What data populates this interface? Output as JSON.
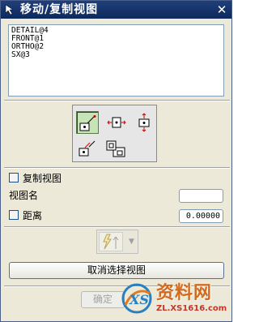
{
  "window": {
    "title": "移动/复制视图",
    "icon": "arrow-cursor-icon",
    "close_glyph": "✕"
  },
  "view_list": {
    "items": [
      "DETAIL@4",
      "FRONT@1",
      "ORTHO@2",
      "SX@3"
    ]
  },
  "tools": {
    "buttons": [
      {
        "name": "to-point-icon",
        "active": true
      },
      {
        "name": "horizontal-icon",
        "active": false
      },
      {
        "name": "vertical-icon",
        "active": false
      },
      {
        "name": "perpendicular-to-line-icon",
        "active": false
      },
      {
        "name": "to-another-drawing-icon",
        "active": false
      }
    ]
  },
  "options": {
    "copy_view_label": "复制视图",
    "copy_view_checked": false,
    "view_name_label": "视图名",
    "view_name_value": "",
    "distance_label": "距离",
    "distance_checked": false,
    "distance_value": "0.00000"
  },
  "vector": {
    "icon": "vector-constructor-icon",
    "dropdown_glyph": "▼"
  },
  "buttons": {
    "deselect_views": "取消选择视图",
    "ok": "确定"
  },
  "watermark": {
    "title": "资料网",
    "url": "ZL.XS1616.com",
    "logo": "xs-logo-icon"
  }
}
